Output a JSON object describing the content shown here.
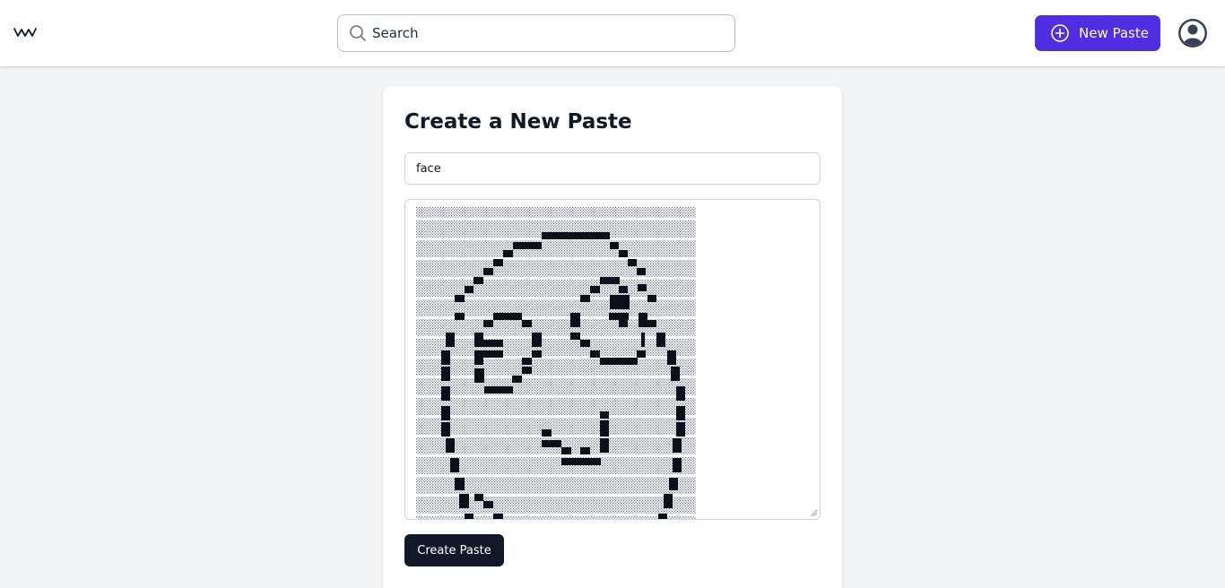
{
  "header": {
    "logo_icon": "wave-icon",
    "search": {
      "placeholder": "Search",
      "value": ""
    },
    "new_paste_label": "New Paste",
    "new_paste_icon": "plus-circle-icon",
    "avatar_icon": "user-circle-icon",
    "accent_color": "#4f2de0"
  },
  "form": {
    "heading": "Create a New Paste",
    "title_value": "face",
    "content_icon": "ascii-art-face",
    "submit_label": "Create Paste",
    "submit_color": "#111827"
  }
}
